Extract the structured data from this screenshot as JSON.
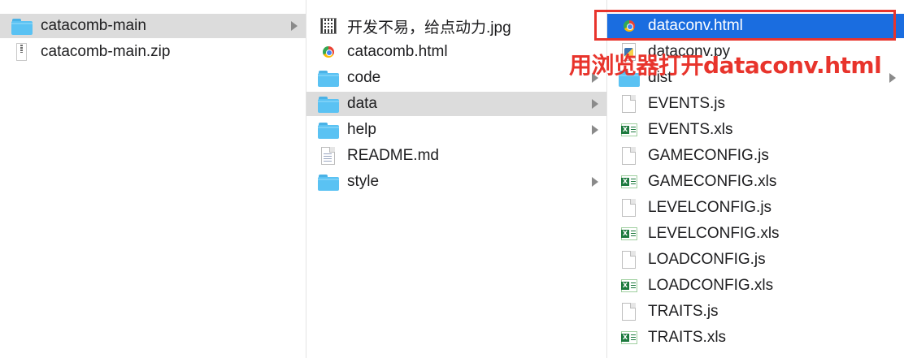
{
  "columns": {
    "col1": {
      "items": [
        {
          "label": "catacomb-main",
          "icon": "folder-icon",
          "state": "selected-inactive",
          "has_children": true
        },
        {
          "label": "catacomb-main.zip",
          "icon": "zip-file-icon",
          "state": "normal",
          "has_children": false
        }
      ]
    },
    "col2": {
      "items": [
        {
          "label": "开发不易，给点动力.jpg",
          "icon": "image-file-icon",
          "has_children": false
        },
        {
          "label": "catacomb.html",
          "icon": "chrome-html-icon",
          "has_children": false
        },
        {
          "label": "code",
          "icon": "folder-icon",
          "has_children": true
        },
        {
          "label": "data",
          "icon": "folder-icon",
          "state": "selected-inactive",
          "has_children": true
        },
        {
          "label": "help",
          "icon": "folder-icon",
          "has_children": true
        },
        {
          "label": "README.md",
          "icon": "text-file-icon",
          "has_children": false
        },
        {
          "label": "style",
          "icon": "folder-icon",
          "has_children": true
        }
      ]
    },
    "col3": {
      "items": [
        {
          "label": "dataconv.html",
          "icon": "chrome-html-icon",
          "state": "selected-active",
          "has_children": false
        },
        {
          "label": "dataconv.py",
          "icon": "python-file-icon",
          "has_children": false
        },
        {
          "label": "dist",
          "icon": "folder-icon",
          "has_children": true
        },
        {
          "label": "EVENTS.js",
          "icon": "js-file-icon",
          "has_children": false
        },
        {
          "label": "EVENTS.xls",
          "icon": "excel-file-icon",
          "has_children": false
        },
        {
          "label": "GAMECONFIG.js",
          "icon": "js-file-icon",
          "has_children": false
        },
        {
          "label": "GAMECONFIG.xls",
          "icon": "excel-file-icon",
          "has_children": false
        },
        {
          "label": "LEVELCONFIG.js",
          "icon": "js-file-icon",
          "has_children": false
        },
        {
          "label": "LEVELCONFIG.xls",
          "icon": "excel-file-icon",
          "has_children": false
        },
        {
          "label": "LOADCONFIG.js",
          "icon": "js-file-icon",
          "has_children": false
        },
        {
          "label": "LOADCONFIG.xls",
          "icon": "excel-file-icon",
          "has_children": false
        },
        {
          "label": "TRAITS.js",
          "icon": "js-file-icon",
          "has_children": false
        },
        {
          "label": "TRAITS.xls",
          "icon": "excel-file-icon",
          "has_children": false
        }
      ]
    }
  },
  "annotation": {
    "text": "用浏览器打开dataconv.html",
    "color": "#e8342c"
  },
  "colors": {
    "selection_active": "#1a6de0",
    "selection_inactive": "#dcdcdc",
    "folder": "#5ac2f3"
  }
}
